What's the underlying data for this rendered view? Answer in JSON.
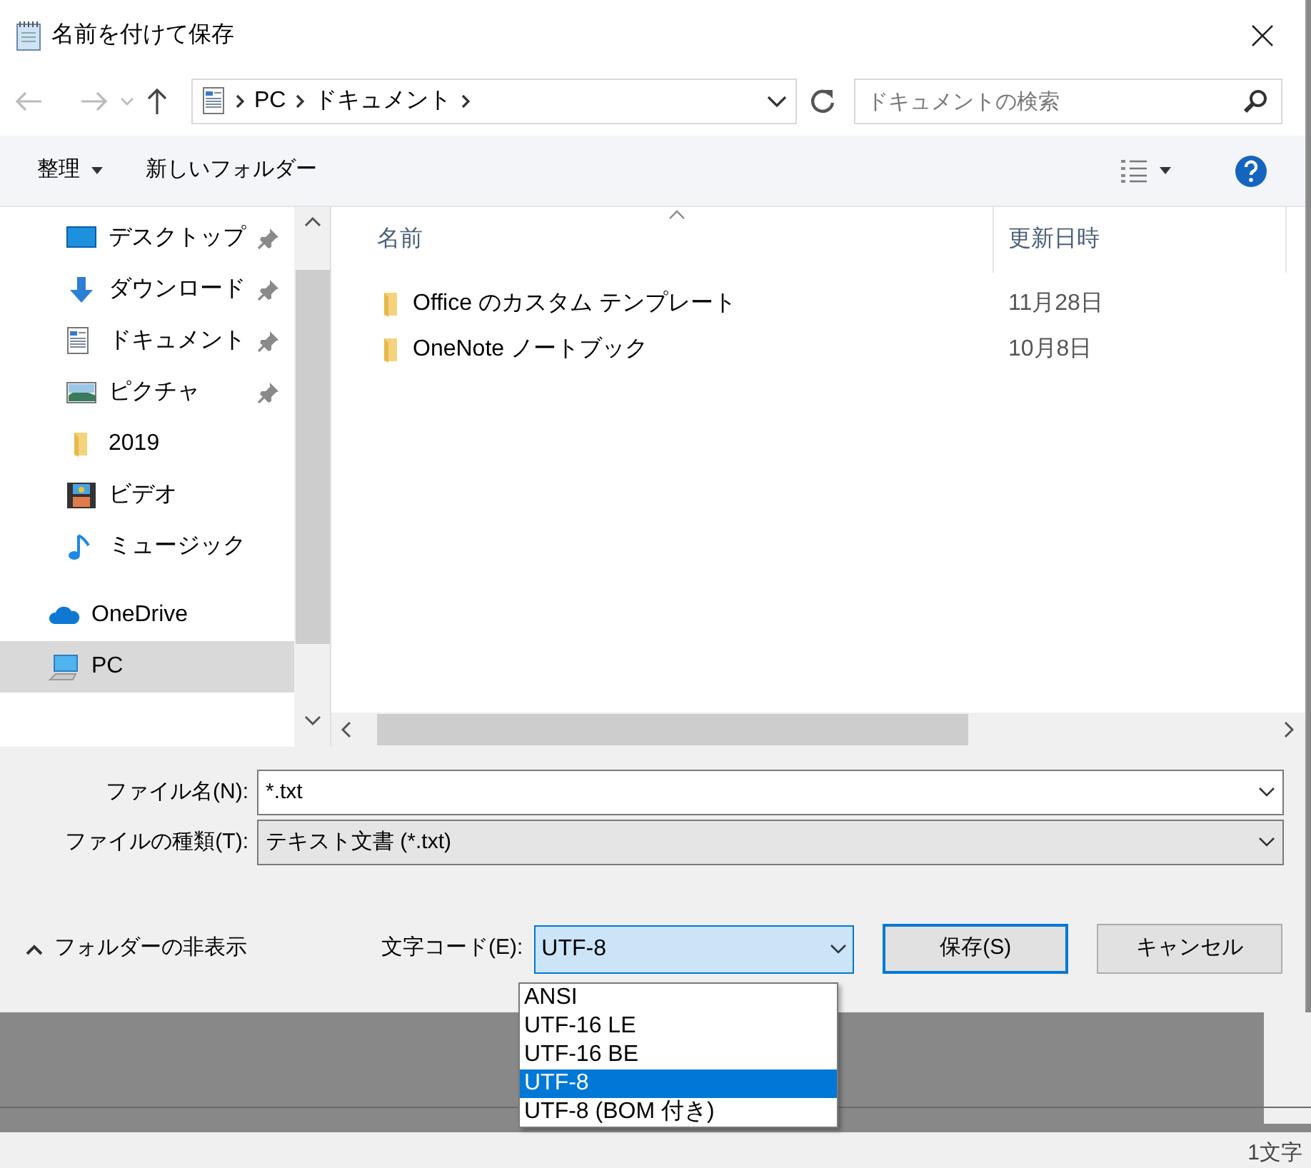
{
  "window": {
    "title": "名前を付けて保存"
  },
  "address": {
    "crumbs": [
      "PC",
      "ドキュメント"
    ]
  },
  "search": {
    "placeholder": "ドキュメントの検索"
  },
  "toolbar": {
    "organize": "整理",
    "new_folder": "新しいフォルダー"
  },
  "nav": {
    "quick_access": {
      "children": [
        {
          "label": "デスクトップ",
          "kind": "desktop",
          "pinned": true,
          "selected": false
        },
        {
          "label": "ダウンロード",
          "kind": "download",
          "pinned": true,
          "selected": false
        },
        {
          "label": "ドキュメント",
          "kind": "document",
          "pinned": true,
          "selected": false
        },
        {
          "label": "ピクチャ",
          "kind": "picture",
          "pinned": true,
          "selected": false
        },
        {
          "label": "2019",
          "kind": "folder",
          "pinned": false,
          "selected": false
        },
        {
          "label": "ビデオ",
          "kind": "video",
          "pinned": false,
          "selected": false
        },
        {
          "label": "ミュージック",
          "kind": "music",
          "pinned": false,
          "selected": false
        }
      ]
    },
    "locations": [
      {
        "label": "OneDrive",
        "kind": "onedrive",
        "pinned": false,
        "selected": false
      },
      {
        "label": "PC",
        "kind": "pc",
        "pinned": false,
        "selected": true
      }
    ]
  },
  "columns": [
    {
      "label": "名前",
      "sorted": true
    },
    {
      "label": "更新日時",
      "sorted": false
    }
  ],
  "files": [
    {
      "name": "Office のカスタム テンプレート",
      "modified": "11月28日"
    },
    {
      "name": "OneNote ノートブック",
      "modified": "10月8日"
    }
  ],
  "file_name": {
    "label": "ファイル名(N):",
    "value": "*.txt"
  },
  "file_type": {
    "label": "ファイルの種類(T):",
    "value": "テキスト文書 (*.txt)"
  },
  "hide_folders": "フォルダーの非表示",
  "encoding": {
    "label": "文字コード(E):",
    "value": "UTF-8",
    "expanded": true,
    "options": [
      {
        "label": "ANSI",
        "selected": false
      },
      {
        "label": "UTF-16 LE",
        "selected": false
      },
      {
        "label": "UTF-16 BE",
        "selected": false
      },
      {
        "label": "UTF-8",
        "selected": true
      },
      {
        "label": "UTF-8 (BOM 付き)",
        "selected": false
      }
    ]
  },
  "buttons": [
    {
      "label": "保存(S)",
      "default": true
    },
    {
      "label": "キャンセル",
      "default": false
    }
  ],
  "background": {
    "status": "1文字"
  }
}
